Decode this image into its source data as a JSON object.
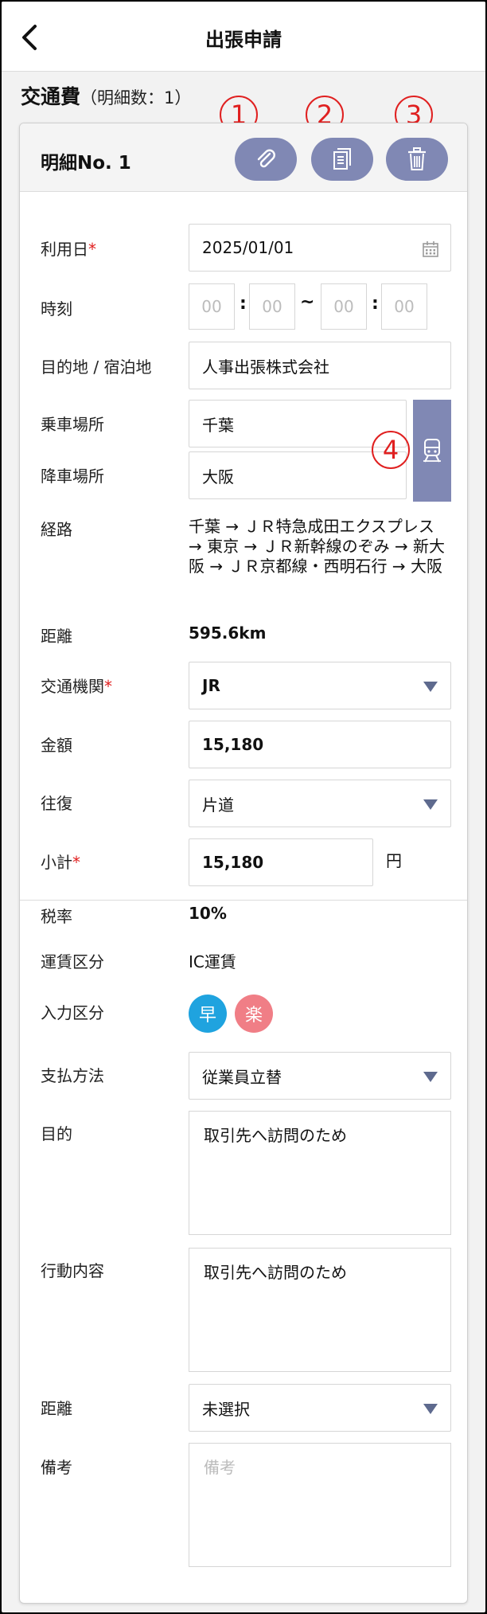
{
  "header": {
    "title": "出張申請",
    "back_icon": "chevron-left-icon"
  },
  "section": {
    "title": "交通費",
    "count_label": "（明細数：1）"
  },
  "callouts": [
    "1",
    "2",
    "3",
    "4"
  ],
  "card": {
    "title": "明細No. 1",
    "actions": [
      {
        "icon": "paperclip-icon"
      },
      {
        "icon": "copy-document-icon"
      },
      {
        "icon": "trash-icon"
      }
    ]
  },
  "form": {
    "usage_date": {
      "label": "利用日",
      "required": "*",
      "value": "2025/01/01",
      "icon": "calendar-icon"
    },
    "time": {
      "label": "時刻",
      "start_h": "00",
      "start_m": "00",
      "end_h": "00",
      "end_m": "00",
      "colon": ":",
      "tilde": "~"
    },
    "destination": {
      "label": "目的地 / 宿泊地",
      "value": "人事出張株式会社"
    },
    "boarding": {
      "label": "乗車場所",
      "value": "千葉"
    },
    "alighting": {
      "label": "降車場所",
      "value": "大阪"
    },
    "route": {
      "label": "経路",
      "value": "千葉 → ＪＲ特急成田エクスプレス → 東京 → ＪＲ新幹線のぞみ → 新大阪 → ＪＲ京都線・西明石行 → 大阪"
    },
    "distance_km": {
      "label": "距離",
      "value": "595.6km"
    },
    "transport": {
      "label": "交通機関",
      "required": "*",
      "value": "JR"
    },
    "amount": {
      "label": "金額",
      "value": "15,180"
    },
    "round_trip": {
      "label": "往復",
      "value": "片道"
    },
    "subtotal": {
      "label": "小計",
      "required": "*",
      "value": "15,180",
      "unit": "円"
    },
    "tax_rate": {
      "label": "税率",
      "value": "10%"
    },
    "fare_type": {
      "label": "運賃区分",
      "value": "IC運賃"
    },
    "input_type": {
      "label": "入力区分",
      "badges": [
        {
          "text": "早",
          "color": "#1fa3df"
        },
        {
          "text": "楽",
          "color": "#f07e86"
        }
      ]
    },
    "payment": {
      "label": "支払方法",
      "value": "従業員立替"
    },
    "purpose": {
      "label": "目的",
      "value": "取引先へ訪問のため"
    },
    "activity": {
      "label": "行動内容",
      "value": "取引先へ訪問のため"
    },
    "distance_select": {
      "label": "距離",
      "value": "未選択"
    },
    "remarks": {
      "label": "備考",
      "placeholder": "備考"
    }
  },
  "colors": {
    "accent": "#8088b4",
    "required": "#e02020",
    "caret": "#5e6a8e"
  }
}
